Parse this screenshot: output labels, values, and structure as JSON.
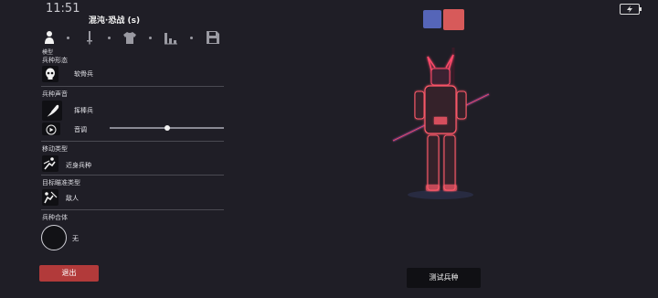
{
  "status_bar": {
    "time": "11:51",
    "battery_icon": "battery-charging-icon"
  },
  "header": {
    "title": "混沌·恐战 (s)"
  },
  "tabs": {
    "items": [
      {
        "icon": "person-icon",
        "active": true
      },
      {
        "icon": "sword-icon"
      },
      {
        "icon": "shirt-icon"
      },
      {
        "icon": "stats-icon"
      },
      {
        "icon": "save-icon"
      }
    ],
    "active_label": "模型"
  },
  "sections": {
    "unit_form": {
      "label": "兵种形态",
      "icon": "skull-mask-icon",
      "value": "软骨兵"
    },
    "unit_sound": {
      "label": "兵种声音",
      "icon": "feather-icon",
      "value": "挥棒兵",
      "pitch_icon": "play-icon",
      "pitch_label": "音调",
      "pitch_level": 0.5
    },
    "movement": {
      "label": "移动类型",
      "icon": "melee-icon",
      "value": "近身兵种"
    },
    "targeting": {
      "label": "目标瞄准类型",
      "icon": "target-enemy-icon",
      "value": "敌人"
    },
    "fusion": {
      "label": "兵种合体",
      "value": "无"
    }
  },
  "buttons": {
    "exit": "退出",
    "test_unit": "测试兵种"
  },
  "team_colors": {
    "blue": "#5565b8",
    "red": "#d75a5a"
  },
  "preview": {
    "figure": "neon-samurai-warrior"
  }
}
